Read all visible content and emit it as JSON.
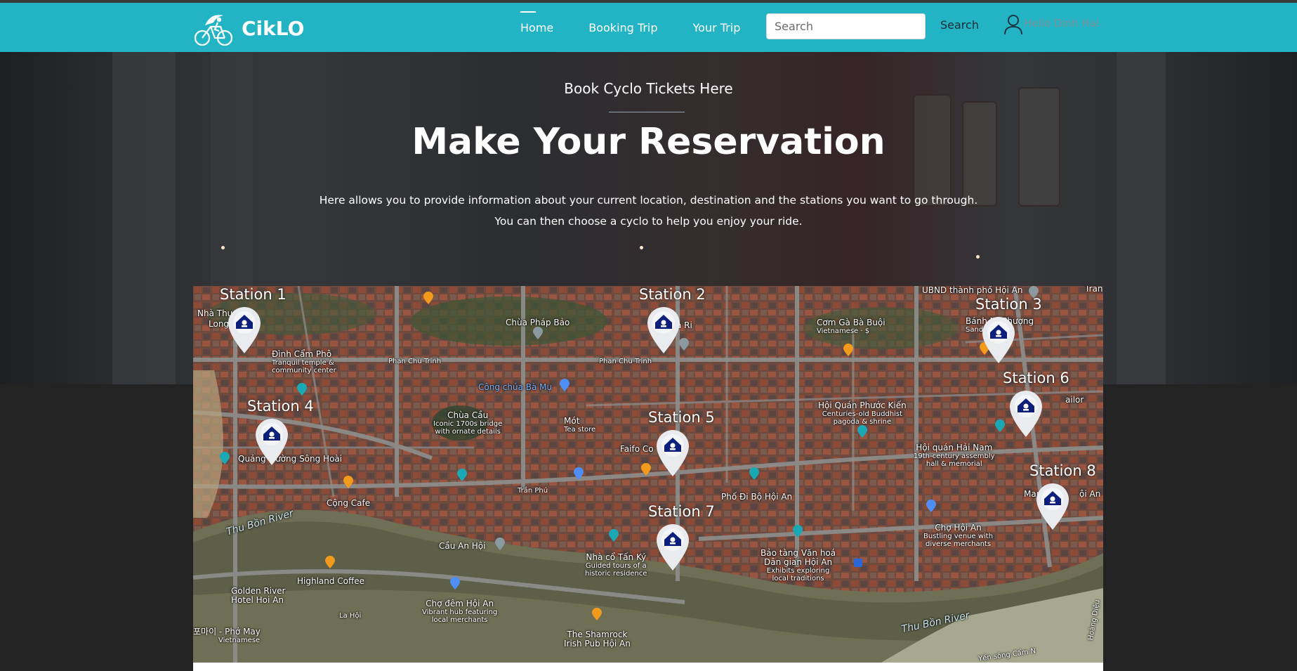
{
  "brand": {
    "name": "CikLO",
    "logo_icon": "cyclo-logo-icon"
  },
  "nav": {
    "items": [
      {
        "label": "Home",
        "active": true
      },
      {
        "label": "Booking Trip",
        "active": false
      },
      {
        "label": "Your Trip",
        "active": false
      }
    ],
    "search_placeholder": "Search",
    "search_button": "Search",
    "user_icon": "user-icon",
    "user_greeting": "Hello Dinh Hai"
  },
  "hero": {
    "subtitle": "Book Cyclo Tickets Here",
    "title": "Make Your Reservation",
    "desc_line1": "Here allows you to provide information about your current location, destination and the stations you want to go through.",
    "desc_line2": "You can then choose a cyclo to help you enjoy your ride."
  },
  "map": {
    "stations": [
      {
        "label": "Station 1"
      },
      {
        "label": "Station 2"
      },
      {
        "label": "Station 3"
      },
      {
        "label": "Station 4"
      },
      {
        "label": "Station 5"
      },
      {
        "label": "Station 6"
      },
      {
        "label": "Station 7"
      },
      {
        "label": "Station 8"
      }
    ],
    "places": {
      "ubnd": "UBND thành phố Hội An",
      "tran": "Trần",
      "nha_thu": "Nhà Thu",
      "long": "Long",
      "chua_phap_bao": "Chùa Pháp Bảo",
      "ba_ri": "a Ri",
      "com_ga": "Cơm Gà Bà Buội",
      "com_ga_desc": "Vietnamese · $",
      "banh_mi": "Bánh Mì Phượng",
      "banh_mi_desc": "Sandwich",
      "dinh_cam_pho": "Đình Cẩm Phô",
      "dinh_cam_pho_desc1": "Tranquil temple &",
      "dinh_cam_pho_desc2": "community center",
      "phan_chu_trinh_1": "Phan Chu Trinh",
      "phan_chu_trinh_2": "Phan Chu Trinh",
      "cong_chua": "Công chúa Bà Mụ",
      "hoi_quan_phuoc_kien": "Hội Quán Phước Kiến",
      "hoi_quan_phuoc_kien_desc1": "Centuries-old Buddhist",
      "hoi_quan_phuoc_kien_desc2": "pagoda & shrine",
      "tailor": "ailor",
      "chua_cau": "Chùa Cầu",
      "chua_cau_desc1": "Iconic 1700s bridge",
      "chua_cau_desc2": "with ornate details",
      "mot": "Mót",
      "mot_desc": "Tea store",
      "faifo": "Faifo Co",
      "hoi_quan_hai_nam": "Hội quán Hải Nam",
      "hoi_quan_hai_nam_desc1": "19th-century assembly",
      "hoi_quan_hai_nam_desc2": "hall & memorial",
      "quang_truong": "Quảng trường Sông Hoài",
      "cong_cafe": "Cộng Cafe",
      "tran_phu": "Trần Phú",
      "pho_di_bo": "Phố Đi Bộ Hội An",
      "market": "Mark",
      "market_an": "ội An",
      "thu_bon_1": "Thu Bồn River",
      "cau_an_hoi": "Cầu An Hội",
      "nha_co": "Nhà cổ Tấn Ký",
      "nha_co_desc1": "Guided tours of a",
      "nha_co_desc2": "historic residence",
      "bao_tang": "Bảo tàng Văn hoá",
      "bao_tang_2": "Dân gian Hội An",
      "bao_tang_desc1": "Exhibits exploring",
      "bao_tang_desc2": "local traditions",
      "cho_hoi_an": "Chợ Hội An",
      "cho_hoi_an_desc1": "Bustling venue with",
      "cho_hoi_an_desc2": "diverse merchants",
      "highland": "Highland Coffee",
      "golden_river": "Golden River",
      "golden_river_2": "Hotel Hoi An",
      "la_hoi": "La Hội",
      "cho_dem": "Chợ đêm Hội An",
      "cho_dem_desc1": "Vibrant hub featuring",
      "cho_dem_desc2": "local merchants",
      "pho_may": "포마이 - Phở May",
      "pho_may_desc": "Vietnamese",
      "shamrock": "The Shamrock",
      "shamrock_2": "Irish Pub Hội An",
      "thu_bon_2": "Thu Bồn River",
      "hoang_dieu": "Hoàng Diệu",
      "yen_song": "Yến sông Cẩm N"
    }
  }
}
